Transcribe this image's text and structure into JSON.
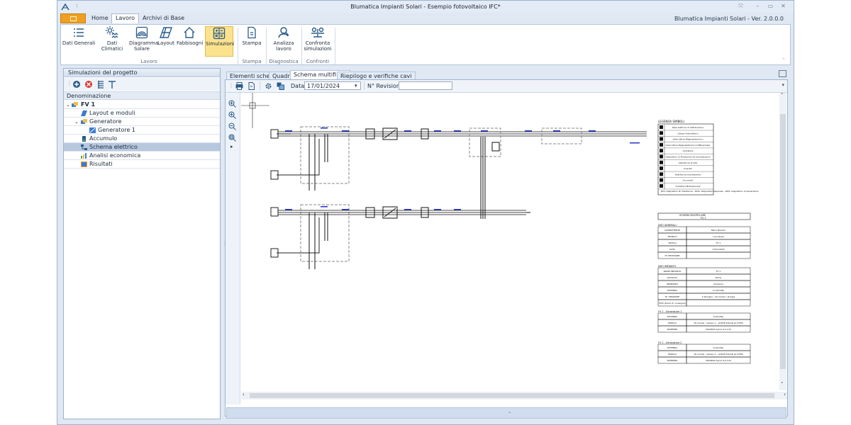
{
  "window": {
    "title": "Blumatica Impianti Solari - Esempio fotovoltaico IFC*",
    "version": "Blumatica Impianti Solari - Ver. 2.0.0.0",
    "quick_access": ":"
  },
  "ribbon_tabs": [
    "Home",
    "Lavoro",
    "Archivi di Base"
  ],
  "ribbon": {
    "lavoro": {
      "dati_generali": "Dati Generali",
      "dati_climatici": "Dati Climatici",
      "diagramma_solare_1": "Diagramma",
      "diagramma_solare_2": "Solare",
      "layout": "Layout",
      "fabbisogni": "Fabbisogni",
      "simulazioni": "Simulazioni",
      "group": "Lavoro"
    },
    "stampa": {
      "stampa": "Stampa",
      "group": "Stampa"
    },
    "diagnostica": {
      "analizza_1": "Analizza",
      "analizza_2": "lavoro",
      "group": "Diagnostica"
    },
    "confronti": {
      "confronta_1": "Confronta",
      "confronta_2": "simulazioni",
      "group": "Confronti"
    }
  },
  "left_panel": {
    "title": "Simulazioni del progetto",
    "column": "Denominazione",
    "tree": [
      {
        "label": "FV 1",
        "level": 0
      },
      {
        "label": "Layout e moduli",
        "level": 1
      },
      {
        "label": "Generatore",
        "level": 1
      },
      {
        "label": "Generatore 1",
        "level": 2
      },
      {
        "label": "Accumulo",
        "level": 1
      },
      {
        "label": "Schema elettrico",
        "level": 1
      },
      {
        "label": "Analisi economica",
        "level": 1
      },
      {
        "label": "Risultati",
        "level": 1
      }
    ]
  },
  "doc_tabs": [
    "Elementi schema",
    "Quadri",
    "Schema multifilare",
    "Riepilogo e verifiche cavi"
  ],
  "doc_toolbar": {
    "data_label": "Data",
    "data_value": "17/01/2024",
    "revisione_label": "N° Revisione",
    "revisione_value": ""
  },
  "legend": {
    "title": "LEGENDA SIMBOLI",
    "items": [
      "Rete elettrica di distribuzione",
      "Campo fotovoltaico",
      "Interruttore Magnetotermico",
      "Interruttore Magnetotermico Differenziale",
      "Contatore",
      "Dispositivo di Protezione da Sovratensioni",
      "Interfaccia di rete",
      "Inverter",
      "Interfaccia di protezione",
      "Accumulo",
      "Contatore Bidirezionale"
    ],
    "notes": "DDI: Dispositivo Di Interfaccia - DDG: Dispositivo Generale - DDS: Dispositivo di Generatore"
  },
  "datasheet": {
    "header_1": "SCHEMA MULTIFILARE",
    "header_2": "FV 1",
    "generali_title": "DATI GENERALI",
    "generali": [
      [
        "COMMITTENTE",
        "Mario Bianchi"
      ],
      [
        "TECNICO",
        "Luca Rossi"
      ],
      [
        "TAVOLA",
        "FV 1"
      ],
      [
        "DATA",
        "17/01/2024"
      ],
      [
        "N° REVISIONE",
        ""
      ]
    ],
    "impianto_title": "DATI IMPIANTO",
    "impianto": [
      [
        "NOME IMPIANTO",
        "FV 1"
      ],
      [
        "LOCALITA'",
        "Roma"
      ],
      [
        "INDIRIZZO",
        "Via Roma"
      ],
      [
        "POTENZA",
        "12,00 kWp"
      ],
      [
        "N° STRINGHE",
        "2 stringhe - 16 moduli / stringa"
      ],
      [
        "POD (Punto di consegna)",
        ""
      ]
    ],
    "gen1_title": "FV 1 - Generatore 1",
    "gen1": [
      [
        "POTENZA",
        "6,00 kWp"
      ],
      [
        "MODULI",
        "16 moduli - Campo 1 - LUXOR SOLAR LX-375M"
      ],
      [
        "INVERTER",
        "FRONIUS Symo 6.0-3-M"
      ]
    ],
    "gen2_title": "FV 1 - Generatore 2",
    "gen2": [
      [
        "POTENZA",
        "6,00 kWp"
      ],
      [
        "MODULI",
        "16 moduli - Campo 1 - LUXOR SOLAR LX-375M"
      ],
      [
        "INVERTER",
        "FRONIUS Symo 6.0-3-M"
      ]
    ]
  },
  "colors": {
    "accent": "#f0a020",
    "selection": "#fbe38d",
    "ribbon_icon": "#2a5c8a",
    "cable": "#2233cc"
  }
}
